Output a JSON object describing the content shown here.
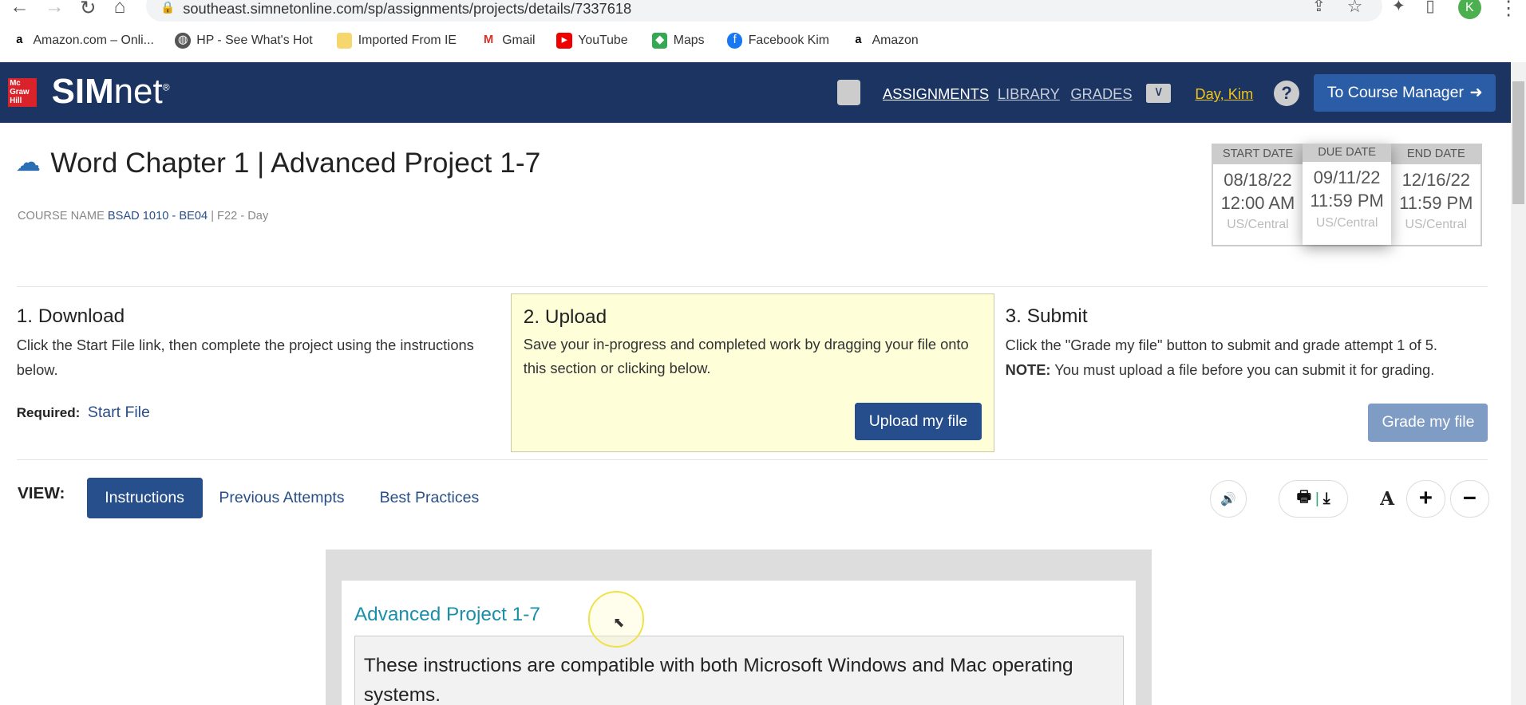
{
  "browser": {
    "url": "southeast.simnetonline.com/sp/assignments/projects/details/7337618",
    "profile_initial": "K",
    "bookmarks": [
      "Amazon.com – Onli...",
      "HP - See What's Hot",
      "Imported From IE",
      "Gmail",
      "YouTube",
      "Maps",
      "Facebook Kim",
      "Amazon"
    ]
  },
  "header": {
    "logo_brand": "Mc Graw Hill",
    "logo": "SIMnet",
    "nav": [
      "ASSIGNMENTS",
      "LIBRARY",
      "GRADES"
    ],
    "user": "Day, Kim",
    "course_manager": "To Course Manager"
  },
  "page": {
    "title": "Word Chapter 1 | Advanced Project 1-7",
    "course_label": "COURSE NAME",
    "course_name": "BSAD 1010 - BE04",
    "course_suffix": "| F22 - Day"
  },
  "dates": [
    {
      "label": "START DATE",
      "date": "08/18/22",
      "time": "12:00 AM",
      "tz": "US/Central"
    },
    {
      "label": "DUE DATE",
      "date": "09/11/22",
      "time": "11:59 PM",
      "tz": "US/Central"
    },
    {
      "label": "END DATE",
      "date": "12/16/22",
      "time": "11:59 PM",
      "tz": "US/Central"
    }
  ],
  "steps": {
    "download": {
      "title": "1. Download",
      "text": "Click the Start File link, then complete the project using the instructions below.",
      "required_label": "Required:",
      "start_file": "Start File"
    },
    "upload": {
      "title": "2. Upload",
      "text": "Save your in-progress and completed work by dragging your file onto this section or clicking below.",
      "button": "Upload my file"
    },
    "submit": {
      "title": "3. Submit",
      "text": "Click the \"Grade my file\" button to submit and grade attempt 1 of 5.",
      "note_label": "NOTE:",
      "note": "You must upload a file before you can submit it for grading.",
      "button": "Grade my file"
    }
  },
  "view": {
    "label": "VIEW:",
    "tabs": [
      "Instructions",
      "Previous Attempts",
      "Best Practices"
    ],
    "font_label": "A",
    "plus": "+",
    "minus": "−"
  },
  "content": {
    "title": "Advanced Project 1-7",
    "intro": "These instructions are compatible with both Microsoft Windows and Mac operating systems."
  },
  "colors": {
    "header": "#1b3461",
    "accent": "#2b5da6",
    "upload_bg": "#fefed8"
  }
}
